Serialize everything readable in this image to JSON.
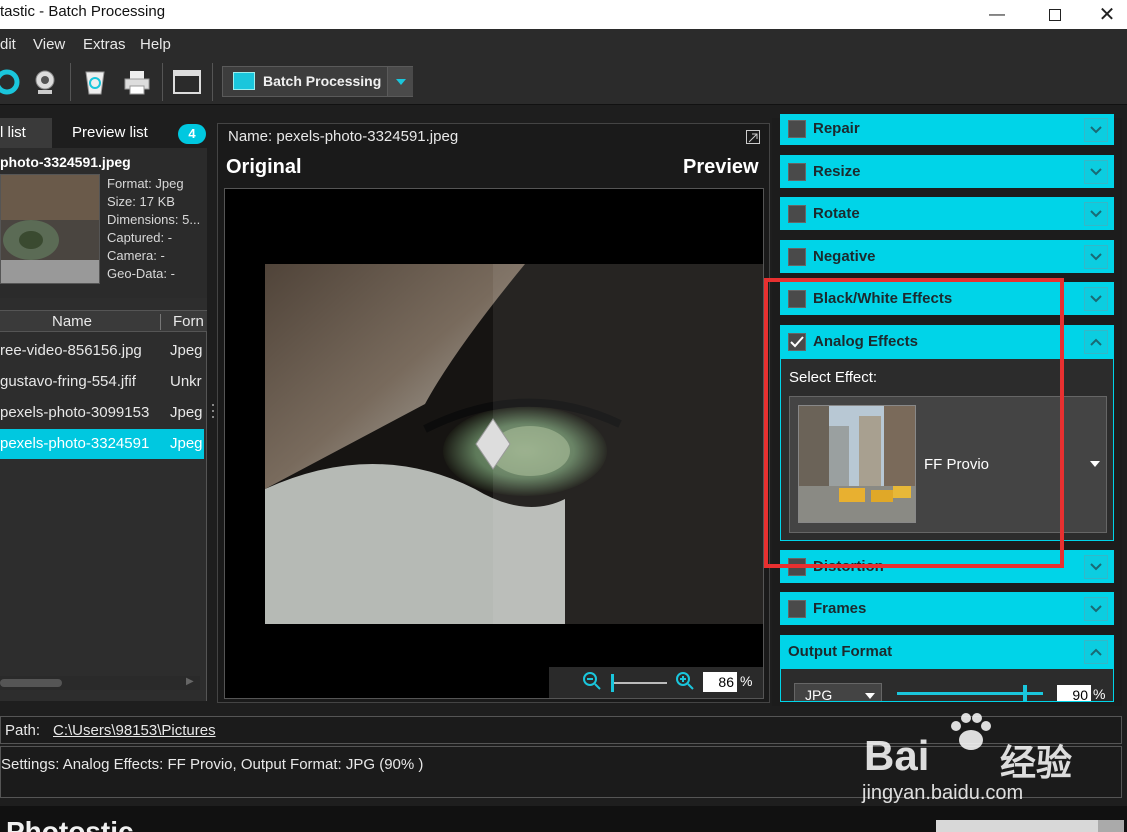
{
  "window": {
    "title": "tastic - Batch Processing"
  },
  "menu": [
    "dit",
    "View",
    "Extras",
    "Help"
  ],
  "toolbar": {
    "batch_label": "Batch Processing"
  },
  "left": {
    "tab1": "l list",
    "tab2": "Preview list",
    "badge": "4",
    "file_name": "photo-3324591.jpeg",
    "info": [
      "Format: Jpeg",
      "Size: 17 KB",
      "Dimensions: 5...",
      "Captured: -",
      "Camera: -",
      "Geo-Data: -"
    ],
    "col_name": "Name",
    "col_format": "Forn",
    "rows": [
      {
        "name": "ree-video-856156.jpg",
        "format": "Jpeg"
      },
      {
        "name": "gustavo-fring-554.jfif",
        "format": "Unkr"
      },
      {
        "name": "pexels-photo-3099153",
        "format": "Jpeg"
      },
      {
        "name": "pexels-photo-3324591",
        "format": "Jpeg"
      }
    ]
  },
  "center": {
    "name_label": "Name: pexels-photo-3324591.jpeg",
    "original": "Original",
    "preview": "Preview",
    "zoom_value": "86",
    "zoom_unit": "%"
  },
  "right": {
    "sections": [
      "Repair",
      "Resize",
      "Rotate",
      "Negative",
      "Black/White Effects",
      "Analog Effects"
    ],
    "select_effect": "Select Effect:",
    "effect_name": "FF Provio",
    "distortion": "Distortion",
    "frames": "Frames",
    "output_format": "Output Format",
    "format_value": "JPG",
    "quality_value": "90",
    "quality_unit": "%"
  },
  "bottom": {
    "path_label": "Path:",
    "path_value": "C:\\Users\\98153\\Pictures",
    "settings": "Settings: Analog Effects: FF Provio, Output Format: JPG (90% )"
  },
  "watermark": {
    "text1": "Bai",
    "text2": "经验",
    "url": "jingyan.baidu.com"
  },
  "footer_text": "Photostic",
  "colors": {
    "accent": "#00d4e8",
    "highlight": "#e83030"
  }
}
